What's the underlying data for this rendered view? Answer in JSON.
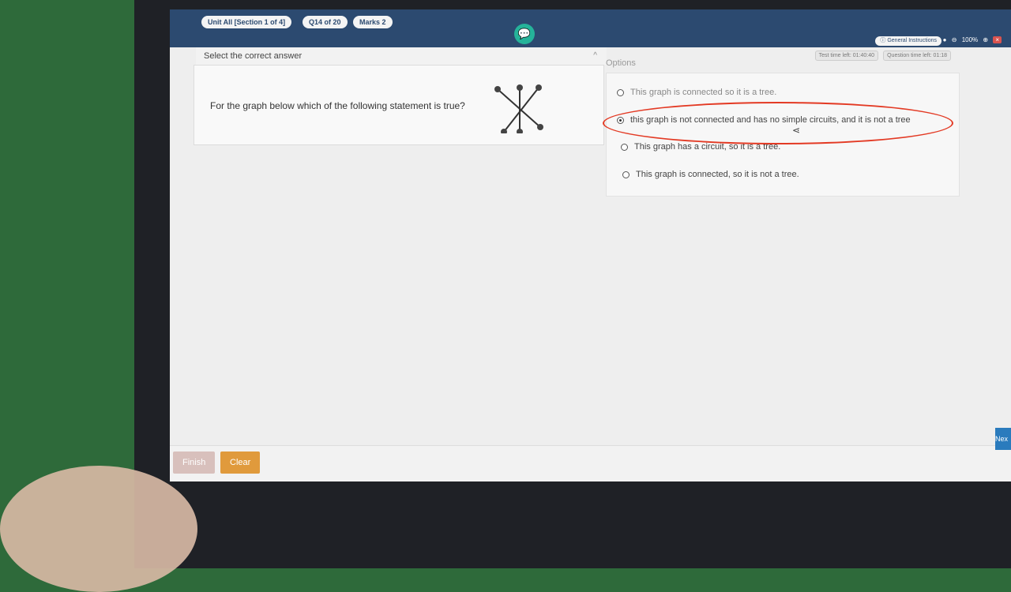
{
  "header": {
    "unit_label": "Unit All [Section 1 of 4]",
    "question_label": "Q14 of 20",
    "marks_label": "Marks 2",
    "general_instructions": "General Instructions",
    "zoom": "100%",
    "test_time": "Test time left: 01:40:40",
    "question_time": "Question time left: 01:18"
  },
  "question": {
    "instruction": "Select the correct answer",
    "text": "For the graph below which of the following statement is true?"
  },
  "options_heading": "Options",
  "options": [
    {
      "label": "This graph is connected so it is a tree.",
      "selected": false
    },
    {
      "label": "this graph is not connected and has no simple circuits, and it is not a tree",
      "selected": true
    },
    {
      "label": "This graph has a circuit, so it is a tree.",
      "selected": false
    },
    {
      "label": "This graph is connected, so it is not a tree.",
      "selected": false
    }
  ],
  "footer": {
    "finish_label": "Finish",
    "clear_label": "Clear",
    "next_label": "Nex"
  },
  "colors": {
    "topbar": "#2c4a70",
    "chat": "#25b39a",
    "clear": "#e09a3c",
    "next": "#2a7bbd",
    "annotation": "#e33a24"
  }
}
